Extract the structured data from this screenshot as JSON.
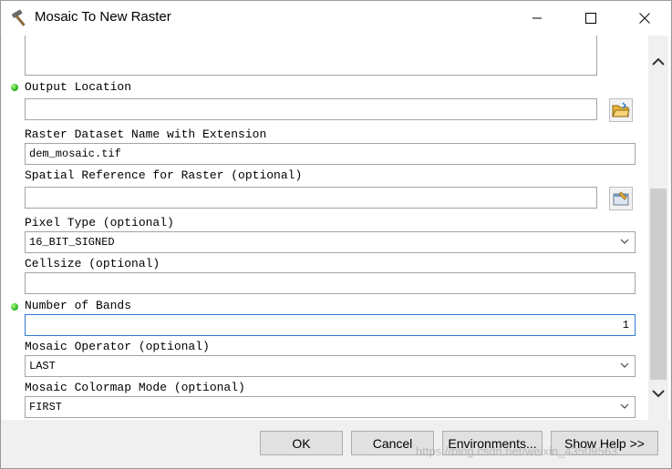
{
  "window": {
    "title": "Mosaic To New Raster",
    "title_icon": "hammer-icon"
  },
  "form": {
    "output_location": {
      "label": "Output Location",
      "value": "",
      "required": true
    },
    "raster_name": {
      "label": "Raster Dataset Name with Extension",
      "value": "dem_mosaic.tif"
    },
    "spatial_reference": {
      "label": "Spatial Reference for Raster (optional)",
      "value": ""
    },
    "pixel_type": {
      "label": "Pixel Type (optional)",
      "value": "16_BIT_SIGNED"
    },
    "cellsize": {
      "label": "Cellsize (optional)",
      "value": ""
    },
    "number_of_bands": {
      "label": "Number of Bands",
      "value": "1",
      "required": true
    },
    "mosaic_operator": {
      "label": "Mosaic Operator (optional)",
      "value": "LAST"
    },
    "colormap_mode": {
      "label": "Mosaic Colormap Mode (optional)",
      "value": "FIRST"
    }
  },
  "buttons": {
    "ok": "OK",
    "cancel": "Cancel",
    "environments": "Environments...",
    "show_help": "Show Help >>"
  },
  "watermark": "https://blog.csdn.net/weixin_43509563",
  "colors": {
    "required_dot": "#1eaa1e",
    "focus_border": "#2e7ad6",
    "folder_yellow": "#e8b43a"
  }
}
